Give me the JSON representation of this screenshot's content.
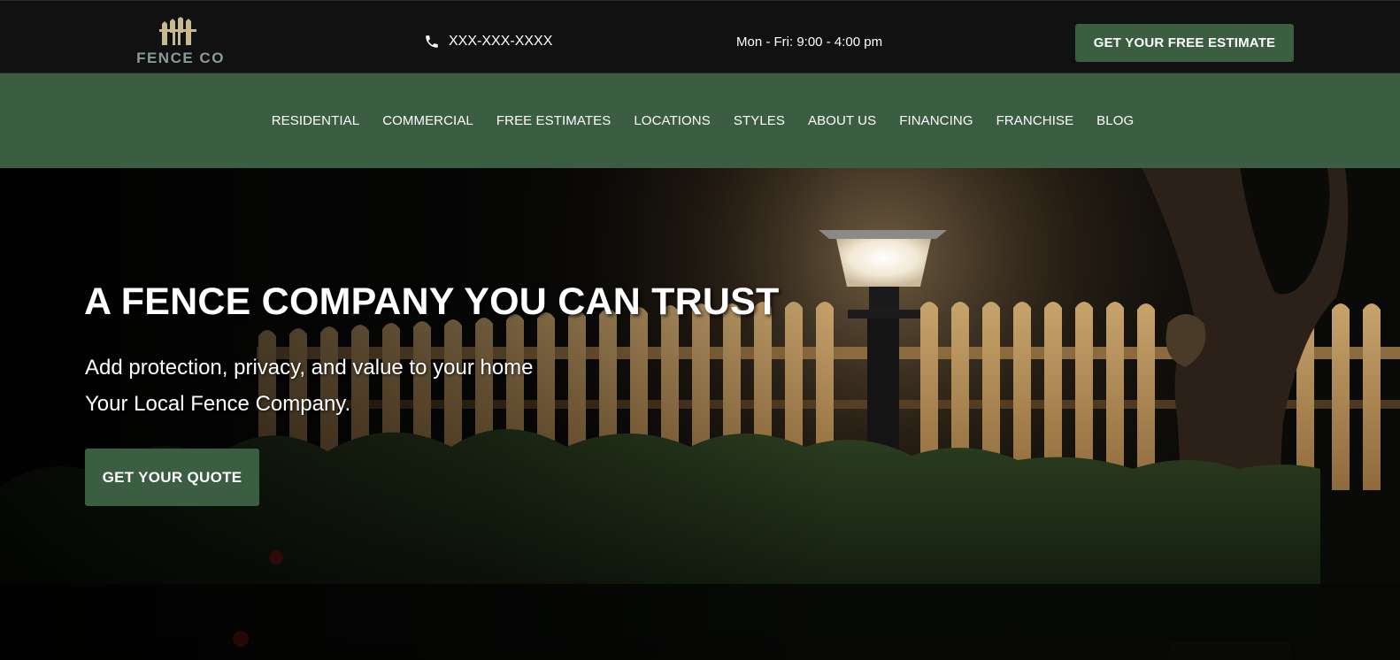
{
  "header": {
    "logo_text": "FENCE CO",
    "phone": "XXX-XXX-XXXX",
    "hours": "Mon - Fri: 9:00 - 4:00 pm",
    "cta_label": "GET YOUR FREE ESTIMATE"
  },
  "nav": {
    "items": [
      {
        "label": "RESIDENTIAL"
      },
      {
        "label": "COMMERCIAL"
      },
      {
        "label": "FREE ESTIMATES"
      },
      {
        "label": "LOCATIONS"
      },
      {
        "label": "STYLES"
      },
      {
        "label": "ABOUT US"
      },
      {
        "label": "FINANCING"
      },
      {
        "label": "FRANCHISE"
      },
      {
        "label": "BLOG"
      }
    ]
  },
  "hero": {
    "title": "A FENCE COMPANY YOU CAN TRUST",
    "subtitle_line1": "Add protection, privacy, and value to your home",
    "subtitle_line2": "Your Local Fence Company.",
    "cta_label": "GET YOUR QUOTE",
    "background": "night-fence-lamp-photo"
  },
  "colors": {
    "topbar_bg": "#111111",
    "brand_green": "#3b5e43",
    "logo_tan": "#c9b98e",
    "logo_text": "#8b9a92"
  },
  "icons": {
    "phone": "phone-icon",
    "logo": "fence-logo-icon"
  }
}
